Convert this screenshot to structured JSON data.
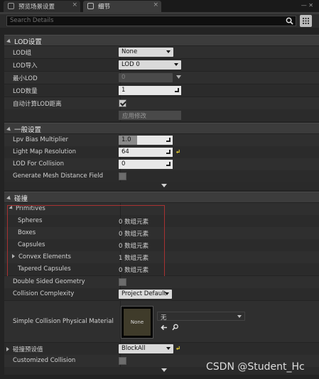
{
  "tabs": [
    {
      "label": "预览场景设置"
    },
    {
      "label": "细节"
    }
  ],
  "search": {
    "placeholder": "Search Details"
  },
  "sections": {
    "lod": {
      "title": "LOD设置",
      "rows": {
        "lod_group": {
          "label": "LOD组",
          "value": "None"
        },
        "lod_import": {
          "label": "LOD导入",
          "value": "LOD 0"
        },
        "min_lod": {
          "label": "最小LOD",
          "value": "0"
        },
        "lod_count": {
          "label": "LOD数量",
          "value": "1"
        },
        "auto_compute": {
          "label": "自动计算LOD距离",
          "checked": true
        },
        "apply": {
          "label": "应用修改"
        }
      }
    },
    "general": {
      "title": "一般设置",
      "rows": {
        "lpv": {
          "label": "Lpv Bias Multiplier",
          "value": "1.0"
        },
        "lightmap": {
          "label": "Light Map Resolution",
          "value": "64"
        },
        "lod_collision": {
          "label": "LOD For Collision",
          "value": "0"
        },
        "mesh_distance": {
          "label": "Generate Mesh Distance Field",
          "checked": false
        }
      }
    },
    "collision": {
      "title": "碰撞",
      "primitives": {
        "label": "Primitives",
        "items": [
          {
            "label": "Spheres",
            "value": "0 数组元素"
          },
          {
            "label": "Boxes",
            "value": "0 数组元素"
          },
          {
            "label": "Capsules",
            "value": "0 数组元素"
          },
          {
            "label": "Convex Elements",
            "value": "1 数组元素"
          },
          {
            "label": "Tapered Capsules",
            "value": "0 数组元素"
          }
        ]
      },
      "double_sided": {
        "label": "Double Sided Geometry",
        "checked": false
      },
      "complexity": {
        "label": "Collision Complexity",
        "value": "Project Default"
      },
      "phys_material": {
        "label": "Simple Collision Physical Material",
        "thumb": "None",
        "value": "无"
      },
      "preset": {
        "label": "碰撞预设值",
        "value": "BlockAll"
      },
      "customized": {
        "label": "Customized Collision",
        "checked": false
      }
    }
  },
  "watermark": "CSDN @Student_Hc",
  "colors": {
    "background": "#232323",
    "row": "#2f2f2f",
    "header": "#3c3c3c",
    "highlight_box": "#a83232"
  }
}
